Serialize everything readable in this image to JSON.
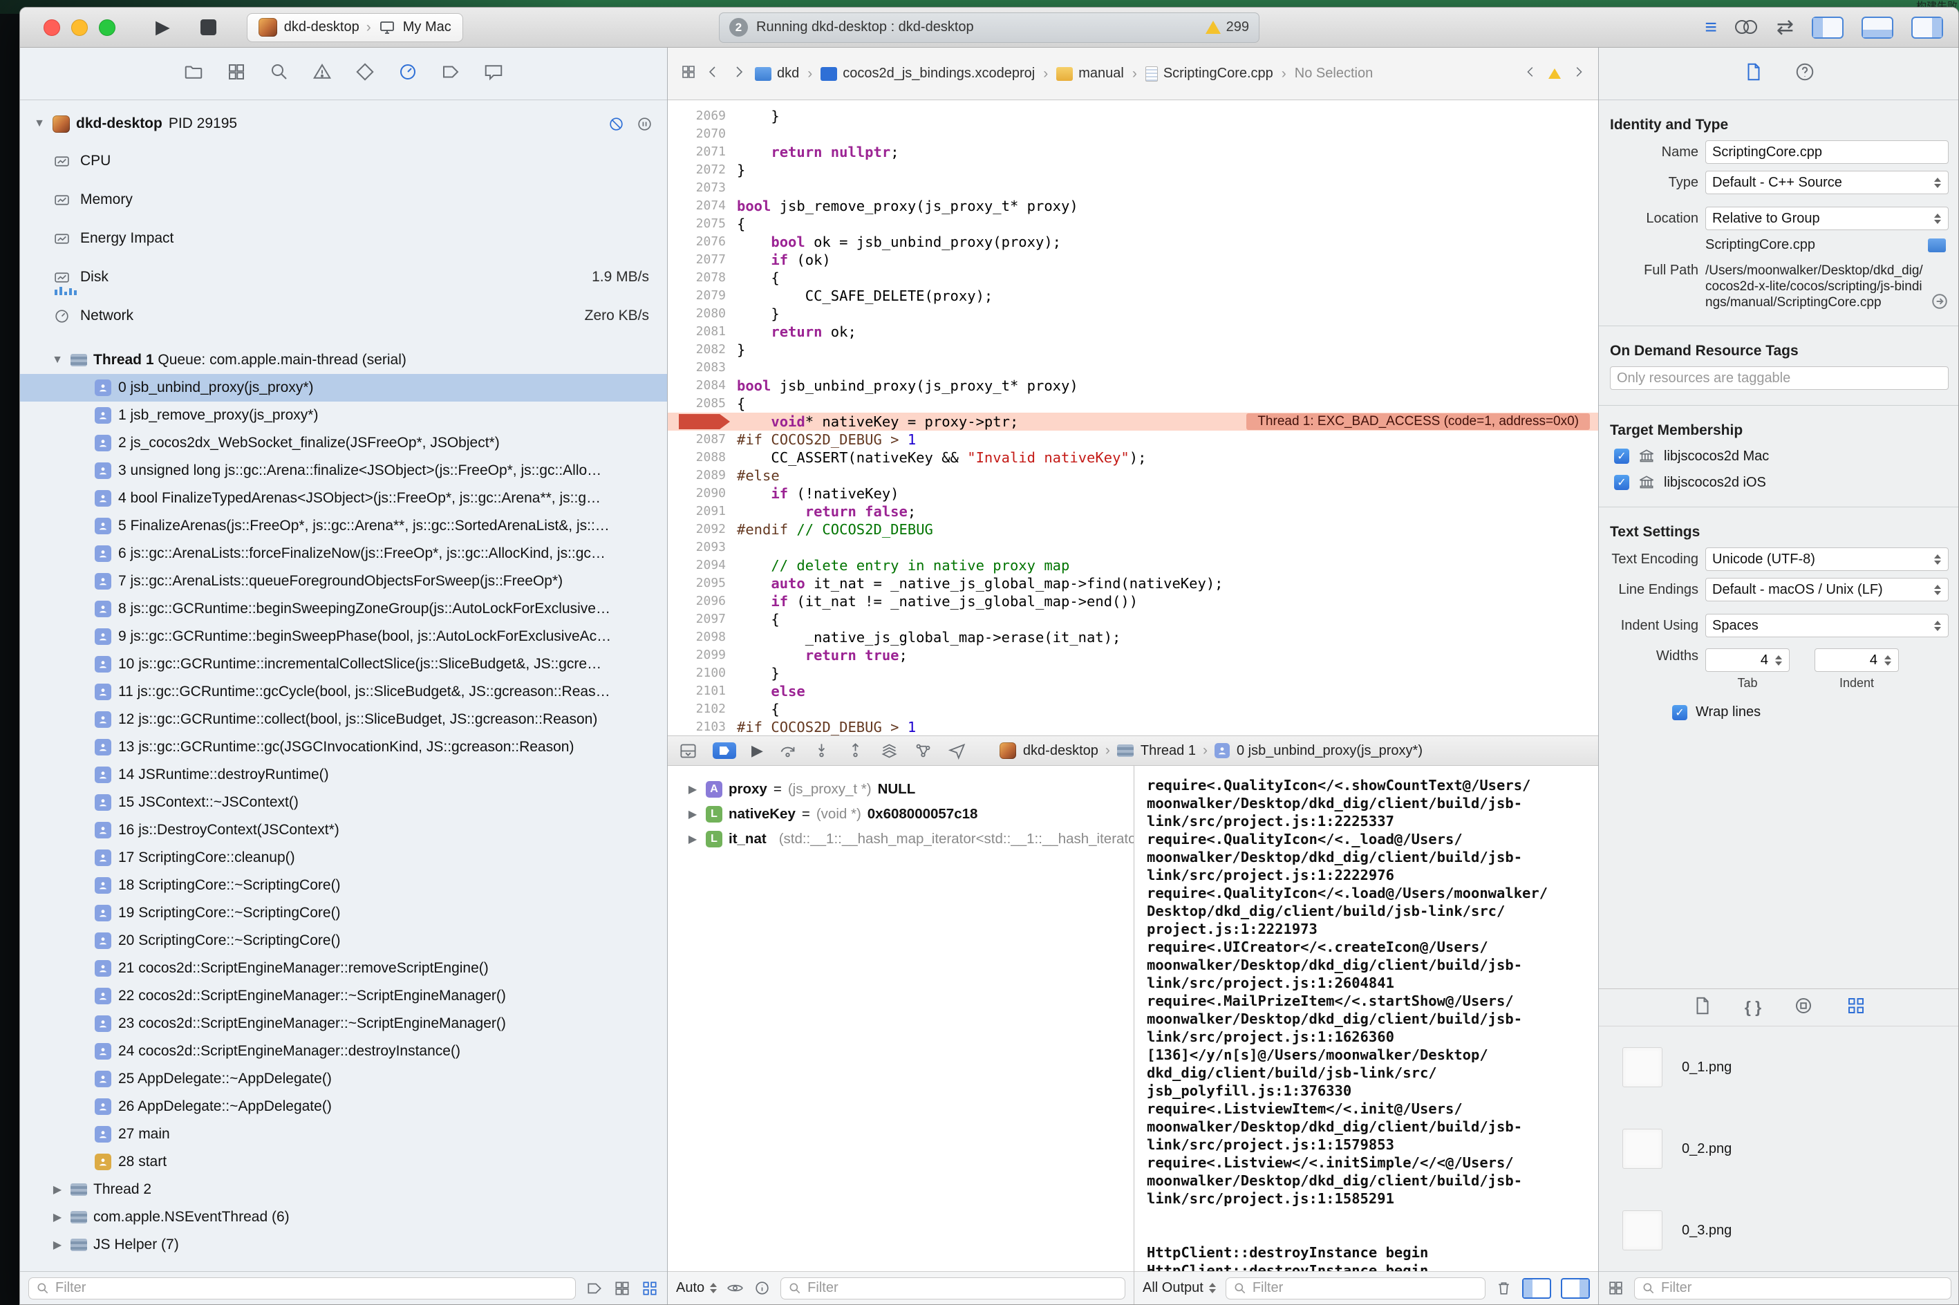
{
  "screen": {
    "menubar_status": "构建失败"
  },
  "titlebar": {
    "scheme_target": "dkd-desktop",
    "scheme_device": "My Mac",
    "status_badge": "2",
    "status_text": "Running dkd-desktop : dkd-desktop",
    "warning_count": "299"
  },
  "navigator": {
    "tabs": [
      "project",
      "symbols",
      "find",
      "issues",
      "tests",
      "debug",
      "breakpoints",
      "reports"
    ],
    "process_name": "dkd-desktop",
    "process_pid": "PID 29195",
    "gauges": [
      {
        "label": "CPU",
        "value": ""
      },
      {
        "label": "Memory",
        "value": ""
      },
      {
        "label": "Energy Impact",
        "value": ""
      },
      {
        "label": "Disk",
        "value": "1.9 MB/s"
      },
      {
        "label": "Network",
        "value": "Zero KB/s"
      }
    ],
    "thread1_label": "Thread 1",
    "thread1_queue": "Queue: com.apple.main-thread (serial)",
    "frames": [
      {
        "n": "0",
        "text": "jsb_unbind_proxy(js_proxy*)",
        "selected": true
      },
      {
        "n": "1",
        "text": "jsb_remove_proxy(js_proxy*)"
      },
      {
        "n": "2",
        "text": "js_cocos2dx_WebSocket_finalize(JSFreeOp*, JSObject*)"
      },
      {
        "n": "3",
        "text": "unsigned long js::gc::Arena::finalize<JSObject>(js::FreeOp*, js::gc::Allo…"
      },
      {
        "n": "4",
        "text": "bool FinalizeTypedArenas<JSObject>(js::FreeOp*, js::gc::Arena**, js::g…"
      },
      {
        "n": "5",
        "text": "FinalizeArenas(js::FreeOp*, js::gc::Arena**, js::gc::SortedArenaList&, js::…"
      },
      {
        "n": "6",
        "text": "js::gc::ArenaLists::forceFinalizeNow(js::FreeOp*, js::gc::AllocKind, js::gc…"
      },
      {
        "n": "7",
        "text": "js::gc::ArenaLists::queueForegroundObjectsForSweep(js::FreeOp*)"
      },
      {
        "n": "8",
        "text": "js::gc::GCRuntime::beginSweepingZoneGroup(js::AutoLockForExclusive…"
      },
      {
        "n": "9",
        "text": "js::gc::GCRuntime::beginSweepPhase(bool, js::AutoLockForExclusiveAc…"
      },
      {
        "n": "10",
        "text": "js::gc::GCRuntime::incrementalCollectSlice(js::SliceBudget&, JS::gcre…"
      },
      {
        "n": "11",
        "text": "js::gc::GCRuntime::gcCycle(bool, js::SliceBudget&, JS::gcreason::Reas…"
      },
      {
        "n": "12",
        "text": "js::gc::GCRuntime::collect(bool, js::SliceBudget, JS::gcreason::Reason)"
      },
      {
        "n": "13",
        "text": "js::gc::GCRuntime::gc(JSGCInvocationKind, JS::gcreason::Reason)"
      },
      {
        "n": "14",
        "text": "JSRuntime::destroyRuntime()"
      },
      {
        "n": "15",
        "text": "JSContext::~JSContext()"
      },
      {
        "n": "16",
        "text": "js::DestroyContext(JSContext*)"
      },
      {
        "n": "17",
        "text": "ScriptingCore::cleanup()"
      },
      {
        "n": "18",
        "text": "ScriptingCore::~ScriptingCore()"
      },
      {
        "n": "19",
        "text": "ScriptingCore::~ScriptingCore()"
      },
      {
        "n": "20",
        "text": "ScriptingCore::~ScriptingCore()"
      },
      {
        "n": "21",
        "text": "cocos2d::ScriptEngineManager::removeScriptEngine()"
      },
      {
        "n": "22",
        "text": "cocos2d::ScriptEngineManager::~ScriptEngineManager()"
      },
      {
        "n": "23",
        "text": "cocos2d::ScriptEngineManager::~ScriptEngineManager()"
      },
      {
        "n": "24",
        "text": "cocos2d::ScriptEngineManager::destroyInstance()"
      },
      {
        "n": "25",
        "text": "AppDelegate::~AppDelegate()"
      },
      {
        "n": "26",
        "text": "AppDelegate::~AppDelegate()"
      },
      {
        "n": "27",
        "text": "main"
      },
      {
        "n": "28",
        "text": "start",
        "icon": "orange"
      }
    ],
    "other_threads": [
      "Thread 2",
      "com.apple.NSEventThread (6)",
      "JS Helper (7)"
    ],
    "filter_placeholder": "Filter"
  },
  "jumpbar": {
    "crumbs": [
      "dkd",
      "cocos2d_js_bindings.xcodeproj",
      "manual",
      "ScriptingCore.cpp",
      "No Selection"
    ]
  },
  "editor": {
    "error_text": "Thread 1: EXC_BAD_ACCESS (code=1, address=0x0)",
    "lines": [
      {
        "n": 2069,
        "t": [
          [
            "d",
            "    }"
          ]
        ]
      },
      {
        "n": 2070,
        "t": []
      },
      {
        "n": 2071,
        "t": [
          [
            "d",
            "    "
          ],
          [
            "k",
            "return"
          ],
          [
            "d",
            " "
          ],
          [
            "k",
            "nullptr"
          ],
          [
            "d",
            ";"
          ]
        ]
      },
      {
        "n": 2072,
        "t": [
          [
            "d",
            "}"
          ]
        ]
      },
      {
        "n": 2073,
        "t": []
      },
      {
        "n": 2074,
        "t": [
          [
            "k",
            "bool"
          ],
          [
            "d",
            " jsb_remove_proxy(js_proxy_t* proxy)"
          ]
        ]
      },
      {
        "n": 2075,
        "t": [
          [
            "d",
            "{"
          ]
        ]
      },
      {
        "n": 2076,
        "t": [
          [
            "d",
            "    "
          ],
          [
            "k",
            "bool"
          ],
          [
            "d",
            " ok = jsb_unbind_proxy(proxy);"
          ]
        ]
      },
      {
        "n": 2077,
        "t": [
          [
            "d",
            "    "
          ],
          [
            "k",
            "if"
          ],
          [
            "d",
            " (ok)"
          ]
        ]
      },
      {
        "n": 2078,
        "t": [
          [
            "d",
            "    {"
          ]
        ]
      },
      {
        "n": 2079,
        "t": [
          [
            "d",
            "        CC_SAFE_DELETE(proxy);"
          ]
        ]
      },
      {
        "n": 2080,
        "t": [
          [
            "d",
            "    }"
          ]
        ]
      },
      {
        "n": 2081,
        "t": [
          [
            "d",
            "    "
          ],
          [
            "k",
            "return"
          ],
          [
            "d",
            " ok;"
          ]
        ]
      },
      {
        "n": 2082,
        "t": [
          [
            "d",
            "}"
          ]
        ]
      },
      {
        "n": 2083,
        "t": []
      },
      {
        "n": 2084,
        "t": [
          [
            "k",
            "bool"
          ],
          [
            "d",
            " jsb_unbind_proxy(js_proxy_t* proxy)"
          ]
        ]
      },
      {
        "n": 2085,
        "t": [
          [
            "d",
            "{"
          ]
        ]
      },
      {
        "n": 2086,
        "hl": true,
        "t": [
          [
            "d",
            "    "
          ],
          [
            "k",
            "void"
          ],
          [
            "d",
            "* nativeKey = proxy->ptr;"
          ]
        ]
      },
      {
        "n": 2087,
        "t": [
          [
            "p",
            "#if COCOS2D_DEBUG > "
          ],
          [
            "n",
            "1"
          ]
        ]
      },
      {
        "n": 2088,
        "t": [
          [
            "d",
            "    CC_ASSERT(nativeKey && "
          ],
          [
            "s",
            "\"Invalid nativeKey\""
          ],
          [
            "d",
            ");"
          ]
        ]
      },
      {
        "n": 2089,
        "t": [
          [
            "p",
            "#else"
          ]
        ]
      },
      {
        "n": 2090,
        "t": [
          [
            "d",
            "    "
          ],
          [
            "k",
            "if"
          ],
          [
            "d",
            " (!nativeKey)"
          ]
        ]
      },
      {
        "n": 2091,
        "t": [
          [
            "d",
            "        "
          ],
          [
            "k",
            "return"
          ],
          [
            "d",
            " "
          ],
          [
            "k",
            "false"
          ],
          [
            "d",
            ";"
          ]
        ]
      },
      {
        "n": 2092,
        "t": [
          [
            "p",
            "#endif "
          ],
          [
            "c",
            "// COCOS2D_DEBUG"
          ]
        ]
      },
      {
        "n": 2093,
        "t": []
      },
      {
        "n": 2094,
        "t": [
          [
            "c",
            "    // delete entry in native proxy map"
          ]
        ]
      },
      {
        "n": 2095,
        "t": [
          [
            "d",
            "    "
          ],
          [
            "k",
            "auto"
          ],
          [
            "d",
            " it_nat = _native_js_global_map->find(nativeKey);"
          ]
        ]
      },
      {
        "n": 2096,
        "t": [
          [
            "d",
            "    "
          ],
          [
            "k",
            "if"
          ],
          [
            "d",
            " (it_nat != _native_js_global_map->end())"
          ]
        ]
      },
      {
        "n": 2097,
        "t": [
          [
            "d",
            "    {"
          ]
        ]
      },
      {
        "n": 2098,
        "t": [
          [
            "d",
            "        _native_js_global_map->erase(it_nat);"
          ]
        ]
      },
      {
        "n": 2099,
        "t": [
          [
            "d",
            "        "
          ],
          [
            "k",
            "return"
          ],
          [
            "d",
            " "
          ],
          [
            "k",
            "true"
          ],
          [
            "d",
            ";"
          ]
        ]
      },
      {
        "n": 2100,
        "t": [
          [
            "d",
            "    }"
          ]
        ]
      },
      {
        "n": 2101,
        "t": [
          [
            "d",
            "    "
          ],
          [
            "k",
            "else"
          ]
        ]
      },
      {
        "n": 2102,
        "t": [
          [
            "d",
            "    {"
          ]
        ]
      },
      {
        "n": 2103,
        "t": [
          [
            "p",
            "#if COCOS2D_DEBUG > "
          ],
          [
            "n",
            "1"
          ]
        ]
      }
    ]
  },
  "debugbar": {
    "crumb_process": "dkd-desktop",
    "crumb_thread": "Thread 1",
    "crumb_frame": "0 jsb_unbind_proxy(js_proxy*)"
  },
  "variables": {
    "rows": [
      {
        "kind": "A",
        "name": "proxy",
        "sep": " = ",
        "type": "(js_proxy_t *)",
        "value": " NULL"
      },
      {
        "kind": "L",
        "name": "nativeKey",
        "sep": " = ",
        "type": "(void *)",
        "value": " 0x608000057c18"
      },
      {
        "kind": "L",
        "name": "it_nat",
        "sep": " ",
        "type": "(std::__1::__hash_map_iterator<std::__1::__hash_iterato…",
        "value": ""
      }
    ],
    "scope": "Auto",
    "filter_placeholder": "Filter"
  },
  "console": {
    "scope": "All Output",
    "filter_placeholder": "Filter",
    "lines": [
      "require<.QualityIcon</<.showCountText@/Users/",
      "moonwalker/Desktop/dkd_dig/client/build/jsb-",
      "link/src/project.js:1:2225337",
      "require<.QualityIcon</<._load@/Users/",
      "moonwalker/Desktop/dkd_dig/client/build/jsb-",
      "link/src/project.js:1:2222976",
      "require<.QualityIcon</<.load@/Users/moonwalker/",
      "Desktop/dkd_dig/client/build/jsb-link/src/",
      "project.js:1:2221973",
      "require<.UICreator</<.createIcon@/Users/",
      "moonwalker/Desktop/dkd_dig/client/build/jsb-",
      "link/src/project.js:1:2604841",
      "require<.MailPrizeItem</<.startShow@/Users/",
      "moonwalker/Desktop/dkd_dig/client/build/jsb-",
      "link/src/project.js:1:1626360",
      "[136]</y/n[s]@/Users/moonwalker/Desktop/",
      "dkd_dig/client/build/jsb-link/src/",
      "jsb_polyfill.js:1:376330",
      "require<.ListviewItem</<.init@/Users/",
      "moonwalker/Desktop/dkd_dig/client/build/jsb-",
      "link/src/project.js:1:1579853",
      "require<.Listview</<.initSimple/</<@/Users/",
      "moonwalker/Desktop/dkd_dig/client/build/jsb-",
      "link/src/project.js:1:1585291",
      "",
      "",
      "HttpClient::destroyInstance begin",
      "HttpClient::destroyInstance begin"
    ]
  },
  "inspector": {
    "identity_header": "Identity and Type",
    "name_label": "Name",
    "name_value": "ScriptingCore.cpp",
    "type_label": "Type",
    "type_value": "Default - C++ Source",
    "location_label": "Location",
    "location_value": "Relative to Group",
    "group_file": "ScriptingCore.cpp",
    "fullpath_label": "Full Path",
    "fullpath_value": "/Users/moonwalker/Desktop/dkd_dig/cocos2d-x-lite/cocos/scripting/js-bindings/manual/ScriptingCore.cpp",
    "odr_header": "On Demand Resource Tags",
    "odr_placeholder": "Only resources are taggable",
    "target_header": "Target Membership",
    "targets": [
      "libjscocos2d Mac",
      "libjscocos2d iOS"
    ],
    "text_header": "Text Settings",
    "encoding_label": "Text Encoding",
    "encoding_value": "Unicode (UTF-8)",
    "lineendings_label": "Line Endings",
    "lineendings_value": "Default - macOS / Unix (LF)",
    "indent_label": "Indent Using",
    "indent_value": "Spaces",
    "widths_label": "Widths",
    "tab_value": "4",
    "indent_width_value": "4",
    "tab_sub": "Tab",
    "indent_sub": "Indent",
    "wrap_label": "Wrap lines",
    "filter_placeholder": "Filter"
  },
  "library": {
    "items": [
      {
        "name": "0_1.png"
      },
      {
        "name": "0_2.png"
      },
      {
        "name": "0_3.png"
      }
    ]
  },
  "colors": {
    "accent_blue": "#2e6fd6",
    "selection_blue": "#b7cde9",
    "error_line_bg": "#fdd6c9",
    "error_badge_bg": "#efa390",
    "warning_yellow": "#f4c22d"
  }
}
